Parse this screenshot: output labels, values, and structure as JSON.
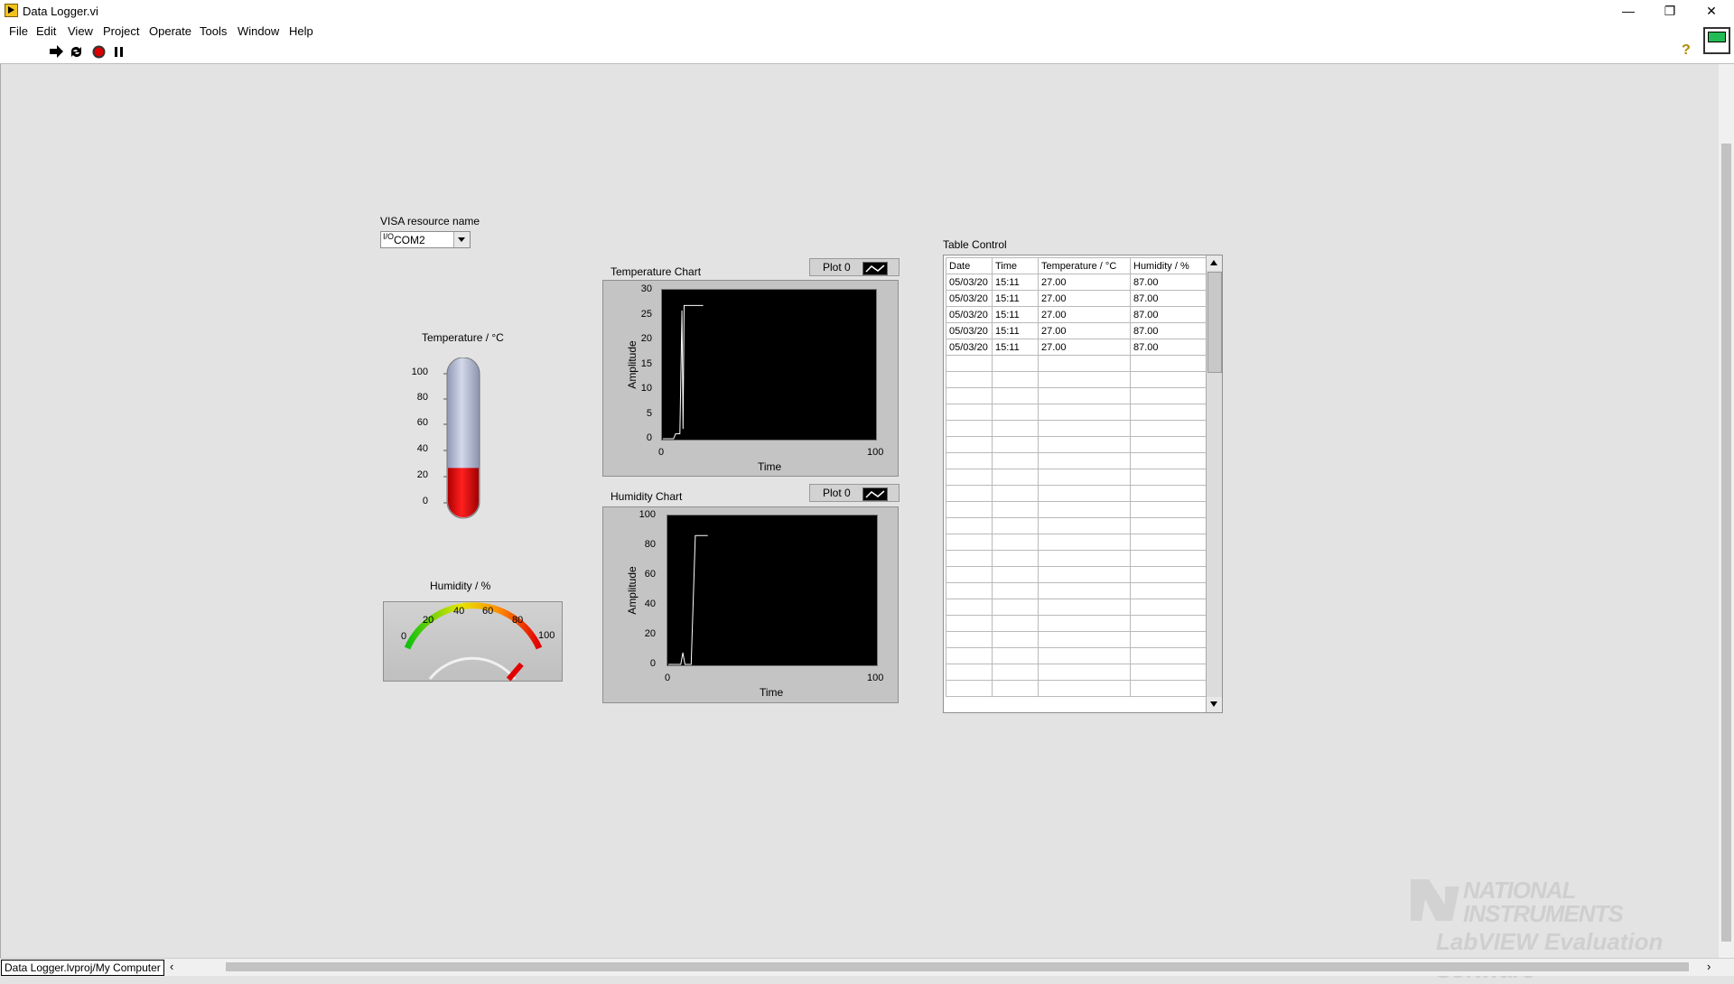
{
  "window": {
    "title": "Data Logger.vi",
    "minimize_glyph": "—",
    "restore_glyph": "❐",
    "close_glyph": "✕"
  },
  "menu": [
    "File",
    "Edit",
    "View",
    "Project",
    "Operate",
    "Tools",
    "Window",
    "Help"
  ],
  "toolbar": {
    "icons": [
      "run-arrow-icon",
      "run-continuously-icon",
      "abort-icon",
      "pause-icon"
    ],
    "help_glyph": "?"
  },
  "visa": {
    "label": "VISA resource name",
    "value": "COM2",
    "icon_glyph": "I/O"
  },
  "thermometer": {
    "label": "Temperature / °C",
    "scale": [
      "100",
      "80",
      "60",
      "40",
      "20",
      "0"
    ],
    "min": 0,
    "max": 100,
    "value": 27,
    "fill_color": "#e00000",
    "tube_color": "#aab4d0"
  },
  "humidity_gauge": {
    "label": "Humidity / %",
    "scale": [
      "0",
      "20",
      "40",
      "60",
      "80",
      "100"
    ],
    "min": 0,
    "max": 100,
    "value": 87,
    "needle_color": "#e00000"
  },
  "temperature_chart": {
    "label": "Temperature Chart",
    "legend": "Plot 0",
    "ylabel": "Amplitude",
    "xlabel": "Time",
    "yticks": [
      "30",
      "25",
      "20",
      "15",
      "10",
      "5",
      "0"
    ],
    "xticks": [
      "0",
      "100"
    ]
  },
  "humidity_chart": {
    "label": "Humidity Chart",
    "legend": "Plot 0",
    "ylabel": "Amplitude",
    "xlabel": "Time",
    "yticks": [
      "100",
      "80",
      "60",
      "40",
      "20",
      "0"
    ],
    "xticks": [
      "0",
      "100"
    ]
  },
  "chart_data": [
    {
      "type": "line",
      "title": "Temperature Chart",
      "xlabel": "Time",
      "ylabel": "Amplitude",
      "xlim": [
        0,
        100
      ],
      "ylim": [
        0,
        30
      ],
      "series": [
        {
          "name": "Plot 0",
          "x": [
            0,
            5,
            6,
            8,
            9,
            9.5,
            10,
            10.5,
            19
          ],
          "y": [
            0,
            0,
            1,
            1,
            26,
            2,
            27,
            27,
            27
          ]
        }
      ]
    },
    {
      "type": "line",
      "title": "Humidity Chart",
      "xlabel": "Time",
      "ylabel": "Amplitude",
      "xlim": [
        0,
        100
      ],
      "ylim": [
        0,
        100
      ],
      "series": [
        {
          "name": "Plot 0",
          "x": [
            0,
            6,
            7,
            8,
            11,
            13,
            19
          ],
          "y": [
            0,
            0,
            8,
            0,
            0,
            87,
            87
          ]
        }
      ]
    }
  ],
  "table": {
    "label": "Table Control",
    "headers": [
      "Date",
      "Time",
      "Temperature / °C",
      "Humidity / %"
    ],
    "rows": [
      [
        "05/03/20",
        "15:11",
        "27.00",
        "87.00"
      ],
      [
        "05/03/20",
        "15:11",
        "27.00",
        "87.00"
      ],
      [
        "05/03/20",
        "15:11",
        "27.00",
        "87.00"
      ],
      [
        "05/03/20",
        "15:11",
        "27.00",
        "87.00"
      ],
      [
        "05/03/20",
        "15:11",
        "27.00",
        "87.00"
      ]
    ],
    "empty_rows": 21
  },
  "status": {
    "path": "Data Logger.lvproj/My Computer"
  },
  "watermark": {
    "line1": "NATIONAL",
    "line2": "INSTRUMENTS",
    "line3": "LabVIEW Evaluation Software"
  }
}
